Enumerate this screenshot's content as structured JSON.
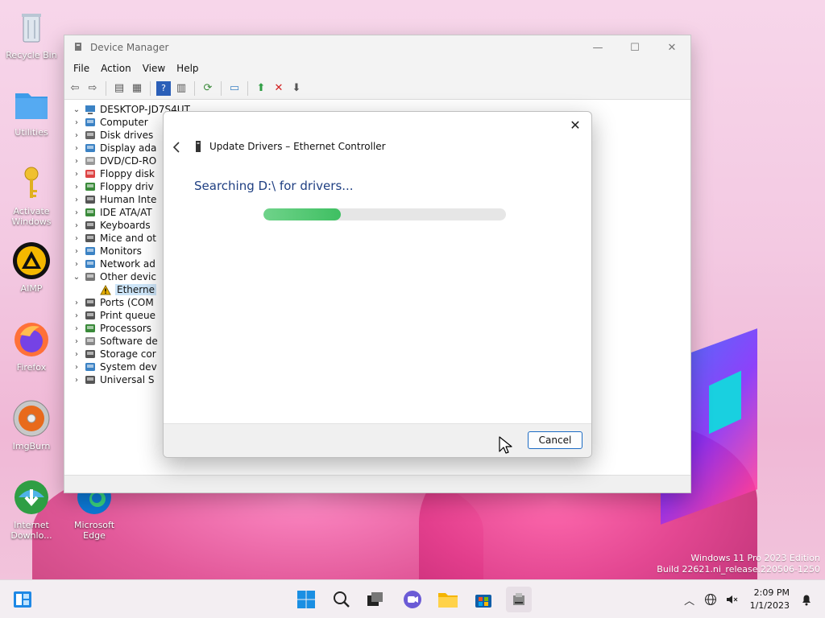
{
  "desktop": {
    "icons": [
      {
        "label": "Recycle Bin",
        "icon": "recycle-bin-icon"
      },
      {
        "label": "Utilities",
        "icon": "folder-icon"
      },
      {
        "label": "Activate Windows",
        "icon": "key-icon"
      },
      {
        "label": "AIMP",
        "icon": "aimp-icon"
      },
      {
        "label": "Firefox",
        "icon": "firefox-icon"
      },
      {
        "label": "ImgBurn",
        "icon": "imgburn-icon"
      },
      {
        "label": "Internet Downlo...",
        "icon": "idm-icon"
      },
      {
        "label": "Microsoft Edge",
        "icon": "edge-icon"
      }
    ]
  },
  "device_manager": {
    "title": "Device Manager",
    "menu": [
      "File",
      "Action",
      "View",
      "Help"
    ],
    "tree": {
      "root": "DESKTOP-JD7S4UT",
      "items": [
        {
          "label": "Computer",
          "icon": "computer-icon",
          "color": "#3b82c4"
        },
        {
          "label": "Disk drives",
          "icon": "disk-icon",
          "color": "#666666"
        },
        {
          "label": "Display ada",
          "icon": "display-icon",
          "color": "#3b82c4"
        },
        {
          "label": "DVD/CD-RO",
          "icon": "dvd-icon",
          "color": "#999999"
        },
        {
          "label": "Floppy disk",
          "icon": "floppy-disk-icon",
          "color": "#d44"
        },
        {
          "label": "Floppy driv",
          "icon": "floppy-drive-icon",
          "color": "#3a8a3a"
        },
        {
          "label": "Human Inte",
          "icon": "hid-icon",
          "color": "#555555"
        },
        {
          "label": "IDE ATA/AT",
          "icon": "ide-icon",
          "color": "#3a8a3a"
        },
        {
          "label": "Keyboards",
          "icon": "keyboard-icon",
          "color": "#555555"
        },
        {
          "label": "Mice and ot",
          "icon": "mouse-icon",
          "color": "#555555"
        },
        {
          "label": "Monitors",
          "icon": "monitor-icon",
          "color": "#3b82c4"
        },
        {
          "label": "Network ad",
          "icon": "network-icon",
          "color": "#3b82c4"
        },
        {
          "label": "Other devic",
          "icon": "other-devices-icon",
          "color": "#777777",
          "expanded": true
        },
        {
          "label": "Etherne",
          "icon": "warning-icon",
          "color": "#e8b000",
          "child": true,
          "selected": true
        },
        {
          "label": "Ports (COM",
          "icon": "ports-icon",
          "color": "#555555"
        },
        {
          "label": "Print queue",
          "icon": "printer-icon",
          "color": "#555555"
        },
        {
          "label": "Processors",
          "icon": "processor-icon",
          "color": "#3a8a3a"
        },
        {
          "label": "Software de",
          "icon": "software-icon",
          "color": "#888888"
        },
        {
          "label": "Storage cor",
          "icon": "storage-icon",
          "color": "#555555"
        },
        {
          "label": "System dev",
          "icon": "system-icon",
          "color": "#3b82c4"
        },
        {
          "label": "Universal S",
          "icon": "usb-icon",
          "color": "#555555"
        }
      ]
    }
  },
  "dialog": {
    "header": "Update Drivers – Ethernet Controller",
    "status": "Searching D:\\ for drivers...",
    "progress": 0.32,
    "cancel_label": "Cancel"
  },
  "watermark": {
    "line1": "Windows 11 Pro 2023 Edition",
    "line2": "Build 22621.ni_release.220506-1250"
  },
  "taskbar": {
    "time": "2:09 PM",
    "date": "1/1/2023"
  }
}
